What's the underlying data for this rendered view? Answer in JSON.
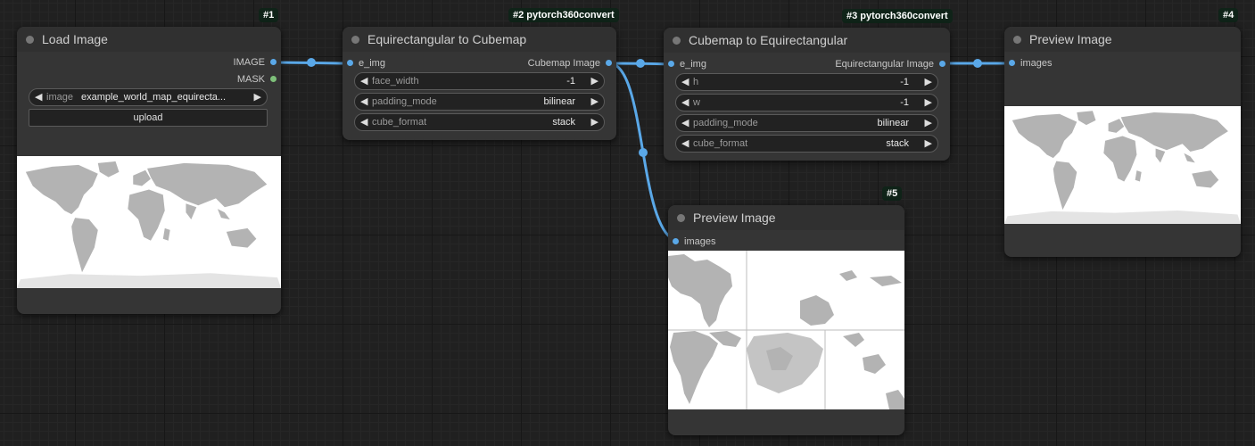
{
  "colors": {
    "link": "#5aa8e8",
    "mask": "#7ec07a",
    "badge_bg": "#0f2318",
    "canvas": "#202020",
    "node": "#353535"
  },
  "nodes": {
    "load_image": {
      "badge": "#1",
      "title": "Load Image",
      "outputs": [
        "IMAGE",
        "MASK"
      ],
      "widget": {
        "label": "image",
        "value": "example_world_map_equirecta..."
      },
      "upload": "upload",
      "preview": "world-map-equirectangular"
    },
    "e2c": {
      "badge": "#2 pytorch360convert",
      "title": "Equirectangular to Cubemap",
      "input": "e_img",
      "output": "Cubemap Image",
      "widgets": [
        {
          "label": "face_width",
          "value": "-1"
        },
        {
          "label": "padding_mode",
          "value": "bilinear"
        },
        {
          "label": "cube_format",
          "value": "stack"
        }
      ]
    },
    "c2e": {
      "badge": "#3 pytorch360convert",
      "title": "Cubemap to Equirectangular",
      "input": "e_img",
      "output": "Equirectangular Image",
      "widgets": [
        {
          "label": "h",
          "value": "-1"
        },
        {
          "label": "w",
          "value": "-1"
        },
        {
          "label": "padding_mode",
          "value": "bilinear"
        },
        {
          "label": "cube_format",
          "value": "stack"
        }
      ]
    },
    "preview4": {
      "badge": "#4",
      "title": "Preview Image",
      "input": "images",
      "preview": "world-map-equirectangular"
    },
    "preview5": {
      "badge": "#5",
      "title": "Preview Image",
      "input": "images",
      "preview": "cubemap-faces"
    }
  }
}
